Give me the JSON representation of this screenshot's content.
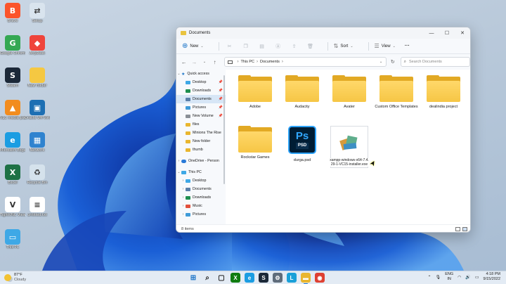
{
  "desktop": {
    "icons": [
      {
        "label": "Brave",
        "color": "#fb542b",
        "glyph": "B"
      },
      {
        "label": "Google Chrome",
        "color": "#34a853",
        "glyph": "G"
      },
      {
        "label": "Steam",
        "color": "#1b2838",
        "glyph": "S"
      },
      {
        "label": "VLC media player",
        "color": "#f28c1e",
        "glyph": "▲"
      },
      {
        "label": "Microsoft Edge",
        "color": "#1b9de2",
        "glyph": "e"
      },
      {
        "label": "Excel",
        "color": "#1e7145",
        "glyph": "X"
      },
      {
        "label": "TightVNC Viewer",
        "color": "#ffffff",
        "glyph": "V"
      },
      {
        "label": "This PC",
        "color": "#3ea8e6",
        "glyph": "▭"
      },
      {
        "label": "Setup",
        "color": "#d9e4ee",
        "glyph": "⇄"
      },
      {
        "label": "AnyDesk",
        "color": "#ef443b",
        "glyph": "◆"
      },
      {
        "label": "New folder",
        "color": "#f5c842",
        "glyph": ""
      },
      {
        "label": "Oracle VM VirtualBox",
        "color": "#1d6fb3",
        "glyph": "▣"
      },
      {
        "label": "Network",
        "color": "#2f83cf",
        "glyph": "▦"
      },
      {
        "label": "Recycle Bin",
        "color": "#d5e2ec",
        "glyph": "♻"
      },
      {
        "label": "untitled.txt",
        "color": "#ffffff",
        "glyph": "≡"
      }
    ]
  },
  "explorer": {
    "title": "Documents",
    "window_controls": {
      "minimize": "—",
      "maximize": "☐",
      "close": "✕"
    },
    "toolbar": {
      "new_label": "New",
      "sort_label": "Sort",
      "view_label": "View",
      "more": "···"
    },
    "address": {
      "root": "This PC",
      "current": "Documents"
    },
    "search_placeholder": "Search Documents",
    "nav": {
      "quick_access": "Quick access",
      "quick_items": [
        {
          "label": "Desktop",
          "pinned": "📌"
        },
        {
          "label": "Downloads",
          "pinned": "📌"
        },
        {
          "label": "Documents",
          "pinned": "📌"
        },
        {
          "label": "Pictures",
          "pinned": "📌"
        },
        {
          "label": "New Volume",
          "pinned": "📌"
        },
        {
          "label": "files",
          "pinned": ""
        },
        {
          "label": "Minions The Rise",
          "pinned": ""
        },
        {
          "label": "New folder",
          "pinned": ""
        },
        {
          "label": "thumb",
          "pinned": ""
        }
      ],
      "onedrive": "OneDrive - Person",
      "this_pc": "This PC",
      "pc_items": [
        "Desktop",
        "Documents",
        "Downloads",
        "Music",
        "Pictures"
      ]
    },
    "files": [
      {
        "name": "Adobe",
        "type": "folder"
      },
      {
        "name": "Audacity",
        "type": "folder"
      },
      {
        "name": "Avater",
        "type": "folder"
      },
      {
        "name": "Custom Office Templates",
        "type": "folder"
      },
      {
        "name": "dealindia project",
        "type": "folder"
      },
      {
        "name": "Rockstar Games",
        "type": "folder"
      },
      {
        "name": "durga.psd",
        "type": "psd"
      },
      {
        "name": "xampp-windows-x64-7.4.29-1-VC15-installer.exe",
        "type": "exe"
      }
    ],
    "psd_icon": {
      "big": "Ps",
      "small": "PSD"
    },
    "status": "8 items"
  },
  "taskbar": {
    "weather_temp": "87°F",
    "weather_desc": "Cloudy",
    "apps": [
      {
        "name": "start-button",
        "glyph": "⊞",
        "color": "#1a73c7"
      },
      {
        "name": "search-button",
        "glyph": "⌕",
        "color": "#222222"
      },
      {
        "name": "task-view-button",
        "glyph": "▢",
        "color": "#222222"
      },
      {
        "name": "xbox-app",
        "glyph": "X",
        "color": "#107c10"
      },
      {
        "name": "edge-app",
        "glyph": "e",
        "color": "#1b9de2"
      },
      {
        "name": "steam-app",
        "glyph": "S",
        "color": "#1b2838"
      },
      {
        "name": "settings-app",
        "glyph": "⚙",
        "color": "#5f6c7b"
      },
      {
        "name": "launcher-app",
        "glyph": "L",
        "color": "#1aa0d8"
      },
      {
        "name": "file-explorer-app",
        "glyph": "▬",
        "color": "#e9b62f"
      },
      {
        "name": "chrome-app",
        "glyph": "◉",
        "color": "#de4032"
      }
    ],
    "lang_top": "ENG",
    "lang_bottom": "IN",
    "time": "4:18 PM",
    "date": "9/15/2022"
  }
}
